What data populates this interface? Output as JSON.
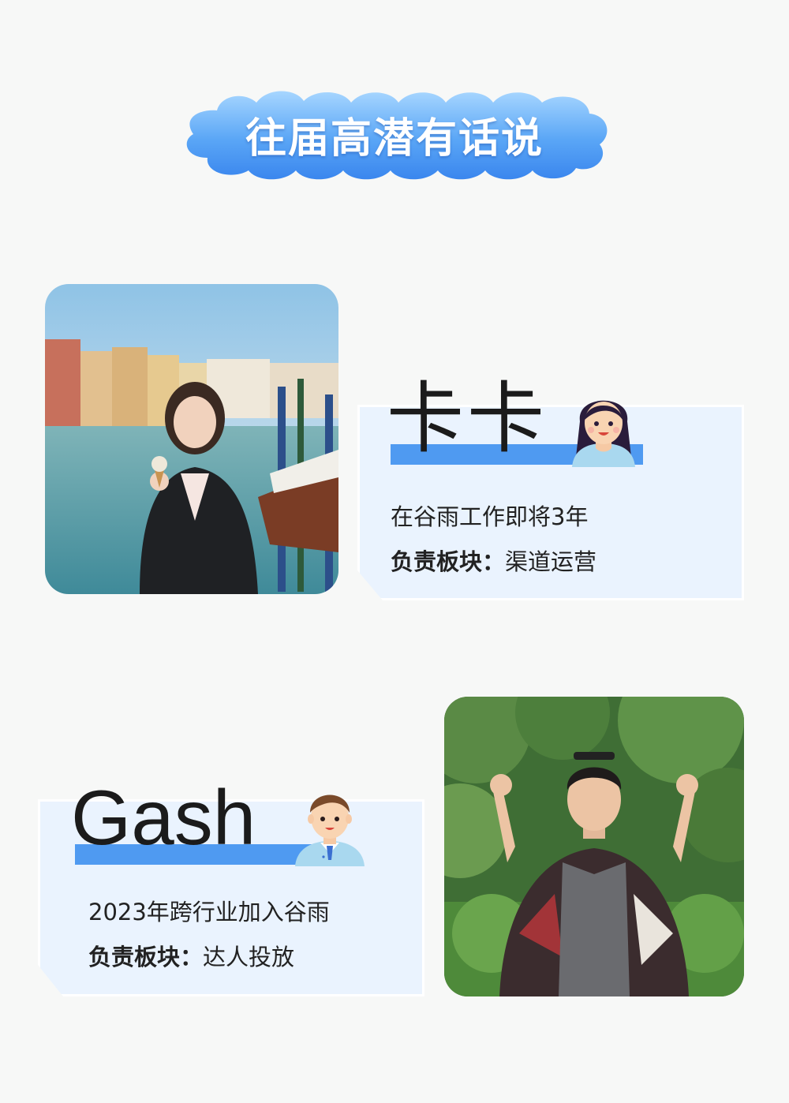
{
  "title": "往届高潜有话说",
  "profiles": [
    {
      "name": "卡卡",
      "line1": "在谷雨工作即将3年",
      "responsibility_label": "负责板块：",
      "responsibility_value": "渠道运营"
    },
    {
      "name": "Gash",
      "line1": "2023年跨行业加入谷雨",
      "responsibility_label": "负责板块：",
      "responsibility_value": "达人投放"
    }
  ],
  "colors": {
    "background": "#f7f8f7",
    "accent_blue": "#4f9af1",
    "card_bg": "#eaf3fe",
    "banner_light": "#9dd0ff",
    "banner_dark": "#3f8ff0"
  },
  "icons": {
    "avatar_1": "girl-avatar-icon",
    "avatar_2": "boy-avatar-icon"
  }
}
